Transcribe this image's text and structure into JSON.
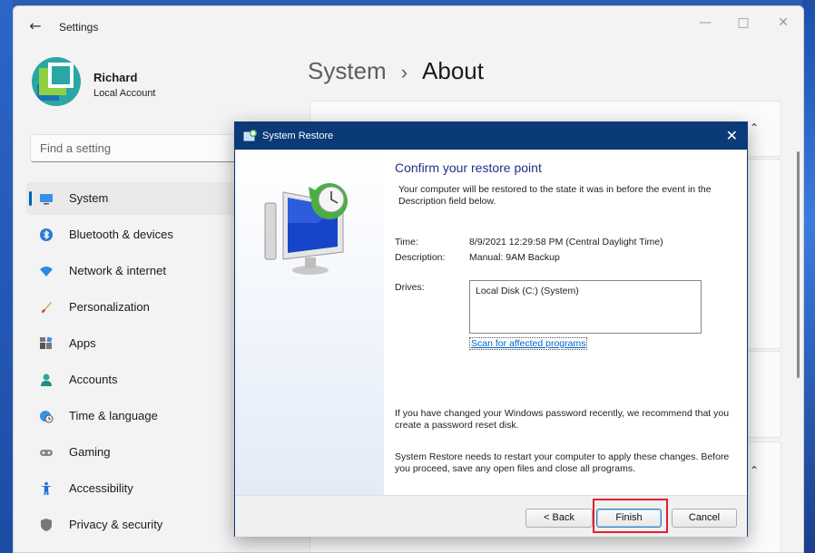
{
  "settings": {
    "title": "Settings",
    "user": {
      "name": "Richard",
      "account_type": "Local Account"
    },
    "search_placeholder": "Find a setting",
    "nav": [
      {
        "label": "System",
        "icon": "monitor-icon",
        "active": true
      },
      {
        "label": "Bluetooth & devices",
        "icon": "bluetooth-icon"
      },
      {
        "label": "Network & internet",
        "icon": "wifi-icon"
      },
      {
        "label": "Personalization",
        "icon": "brush-icon"
      },
      {
        "label": "Apps",
        "icon": "apps-icon"
      },
      {
        "label": "Accounts",
        "icon": "person-icon"
      },
      {
        "label": "Time & language",
        "icon": "globe-clock-icon"
      },
      {
        "label": "Gaming",
        "icon": "gamepad-icon"
      },
      {
        "label": "Accessibility",
        "icon": "accessibility-icon"
      },
      {
        "label": "Privacy & security",
        "icon": "shield-icon"
      }
    ],
    "breadcrumb": {
      "parent": "System",
      "separator": "›",
      "current": "About"
    }
  },
  "dialog": {
    "title": "System Restore",
    "heading": "Confirm your restore point",
    "intro": "Your computer will be restored to the state it was in before the event in the Description field below.",
    "time_label": "Time:",
    "time_value": "8/9/2021 12:29:58 PM (Central Daylight Time)",
    "description_label": "Description:",
    "description_value": "Manual: 9AM Backup",
    "drives_label": "Drives:",
    "drives_value": "Local Disk (C:) (System)",
    "scan_link": "Scan for affected programs",
    "password_note": "If you have changed your Windows password recently, we recommend that you create a password reset disk.",
    "restart_note": "System Restore needs to restart your computer to apply these changes. Before you proceed, save any open files and close all programs.",
    "buttons": {
      "back": "< Back",
      "finish": "Finish",
      "cancel": "Cancel"
    }
  },
  "colors": {
    "accent": "#005fb8",
    "dialog_titlebar": "#0b3a78",
    "heading": "#1e3287",
    "link": "#0066cc",
    "highlight": "#e0202c"
  }
}
